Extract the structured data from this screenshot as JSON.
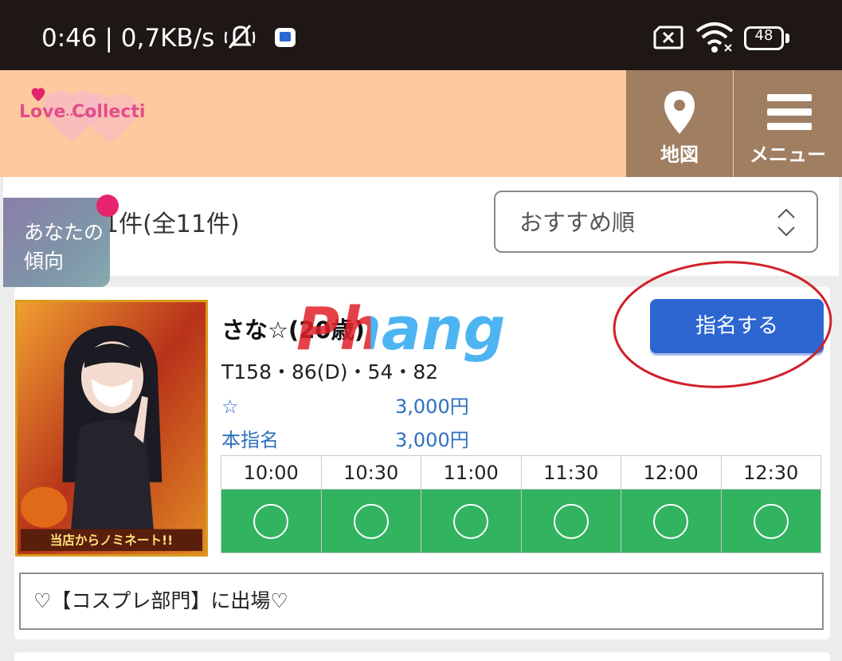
{
  "status_bar": {
    "time": "0:46 | 0,7KB/s",
    "battery_level": "48",
    "icons": [
      "mute-icon",
      "app-notification-icon",
      "no-sim-icon",
      "wifi-icon",
      "battery-icon"
    ]
  },
  "header": {
    "logo_text": "Love Collection",
    "map_label": "地図",
    "menu_label": "メニュー",
    "background_color": "#fdc99e",
    "nav_color": "#a07e62"
  },
  "results": {
    "count_text": "1件(全11件)",
    "sort_selected": "おすすめ順"
  },
  "tendency_tab": {
    "label": "あなたの傾向"
  },
  "girl": {
    "name": "さな☆(20歳)",
    "stats": "T158・86(D)・54・82",
    "prices": [
      {
        "label": "☆",
        "value": "3,000円"
      },
      {
        "label": "本指名",
        "value": "3,000円"
      }
    ],
    "nominate_label": "指名する",
    "photo_banner": "当店からノミネート!!",
    "schedule": [
      {
        "time": "10:00",
        "status": "◯"
      },
      {
        "time": "10:30",
        "status": "◯"
      },
      {
        "time": "11:00",
        "status": "◯"
      },
      {
        "time": "11:30",
        "status": "◯"
      },
      {
        "time": "12:00",
        "status": "◯"
      },
      {
        "time": "12:30",
        "status": "◯"
      }
    ],
    "comment": "♡【コスプレ部門】に出場♡"
  },
  "watermark": "Phang",
  "colors": {
    "accent_blue": "#2d66d1",
    "available_green": "#31b360",
    "price_blue": "#2f6fc0",
    "highlight_red": "#d0202a",
    "badge_pink": "#e6246d"
  }
}
